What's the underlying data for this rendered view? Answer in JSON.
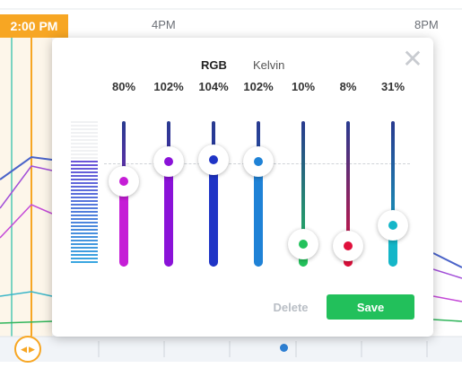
{
  "timeline": {
    "current_time": "2:00 PM",
    "time_labels": [
      "4PM",
      "8PM"
    ]
  },
  "editor": {
    "modes": {
      "rgb": "RGB",
      "kelvin": "Kelvin",
      "active": "RGB"
    },
    "close_icon": "close-icon",
    "preview_gradient": [
      "#6a55d8",
      "#3aa6e0"
    ],
    "sliders": [
      {
        "percent": "80%",
        "level": 0.8,
        "color": "#c51ed6"
      },
      {
        "percent": "102%",
        "level": 1.02,
        "color": "#8a12d8"
      },
      {
        "percent": "104%",
        "level": 1.04,
        "color": "#1f34c6"
      },
      {
        "percent": "102%",
        "level": 1.02,
        "color": "#1f82d6"
      },
      {
        "percent": "10%",
        "level": 0.1,
        "color": "#23c25c"
      },
      {
        "percent": "8%",
        "level": 0.08,
        "color": "#e0103c"
      },
      {
        "percent": "31%",
        "level": 0.31,
        "color": "#14b6c8"
      }
    ],
    "actions": {
      "delete": "Delete",
      "save": "Save"
    }
  }
}
